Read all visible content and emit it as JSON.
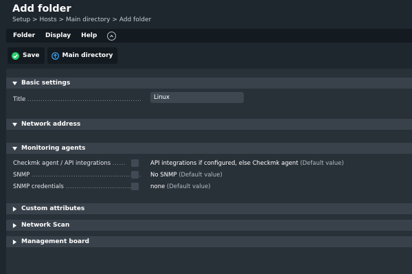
{
  "header": {
    "title": "Add folder",
    "breadcrumb": "Setup > Hosts > Main directory > Add folder"
  },
  "menubar": {
    "items": [
      "Folder",
      "Display",
      "Help"
    ],
    "toggle_icon": "chevron-up-circle-icon"
  },
  "toolbar": {
    "save_label": "Save",
    "save_icon_color": "#29cc6e",
    "main_directory_label": "Main directory",
    "main_directory_icon_color": "#3d9ee8"
  },
  "sections": {
    "basic_settings": {
      "label": "Basic settings",
      "expanded": true,
      "title_label": "Title",
      "title_value": "Linux"
    },
    "network_address": {
      "label": "Network address",
      "expanded": false
    },
    "monitoring_agents": {
      "label": "Monitoring agents",
      "expanded": true,
      "rows": [
        {
          "label": "Checkmk agent / API integrations",
          "value": "API integrations if configured, else Checkmk agent",
          "default_note": "(Default value)"
        },
        {
          "label": "SNMP",
          "value": "No SNMP",
          "default_note": "(Default value)"
        },
        {
          "label": "SNMP credentials",
          "value": "none",
          "default_note": "(Default value)"
        }
      ]
    },
    "custom_attributes": {
      "label": "Custom attributes",
      "expanded": false
    },
    "network_scan": {
      "label": "Network Scan",
      "expanded": false
    },
    "management_board": {
      "label": "Management board",
      "expanded": false
    }
  }
}
